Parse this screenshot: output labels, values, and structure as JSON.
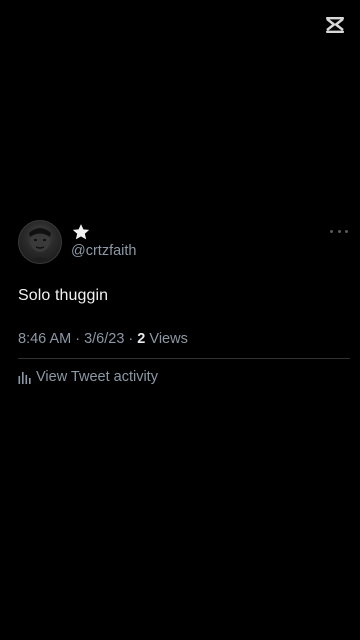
{
  "app": {
    "watermark_icon": "capcut-logo-icon"
  },
  "tweet": {
    "avatar_icon": "user-avatar-photo",
    "name_icon": "star-icon",
    "handle": "@crtzfaith",
    "more_icon": "more-horizontal-icon",
    "text": "Solo thuggin",
    "timestamp": "8:46 AM · 3/6/23 · ",
    "view_count": "2",
    "views_label": " Views",
    "activity_icon": "bar-chart-icon",
    "activity_label": "View Tweet activity"
  },
  "colors": {
    "background": "#000000",
    "primary_text": "#e7e9ea",
    "secondary_text": "#8b98a5",
    "divider": "#2f3336"
  }
}
